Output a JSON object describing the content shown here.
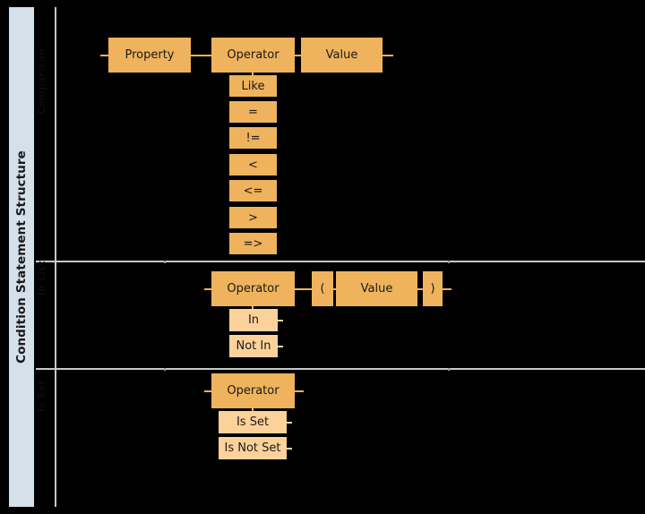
{
  "diagram": {
    "side_label": "Condition Statement Structure",
    "rows": [
      {
        "name": "comparison-row",
        "label": "Comparison",
        "sequence": [
          {
            "text": "Property",
            "tone": "primary"
          },
          {
            "text": "Operator",
            "tone": "primary"
          },
          {
            "text": "Value",
            "tone": "primary"
          }
        ],
        "operator_options": [
          "Like",
          "=",
          "!=",
          "<",
          "<=",
          ">",
          "=>"
        ]
      },
      {
        "name": "membership-row",
        "label": "In List",
        "sequence": [
          {
            "text": "Operator",
            "tone": "primary"
          },
          {
            "text": "(",
            "tone": "primary"
          },
          {
            "text": "Value",
            "tone": "primary"
          },
          {
            "text": ")",
            "tone": "primary"
          }
        ],
        "operator_options": [
          "In",
          "Not In"
        ]
      },
      {
        "name": "existence-row",
        "label": "Is Set",
        "sequence": [
          {
            "text": "Operator",
            "tone": "primary"
          }
        ],
        "operator_options": [
          "Is Set",
          "Is Not Set"
        ]
      }
    ],
    "colors": {
      "background": "#000000",
      "box_primary": "#eeb35c",
      "box_secondary": "#fcd29a",
      "side_band": "#d4e0ea",
      "rule": "#c8c8c8",
      "text": "#1a1a1a"
    }
  }
}
